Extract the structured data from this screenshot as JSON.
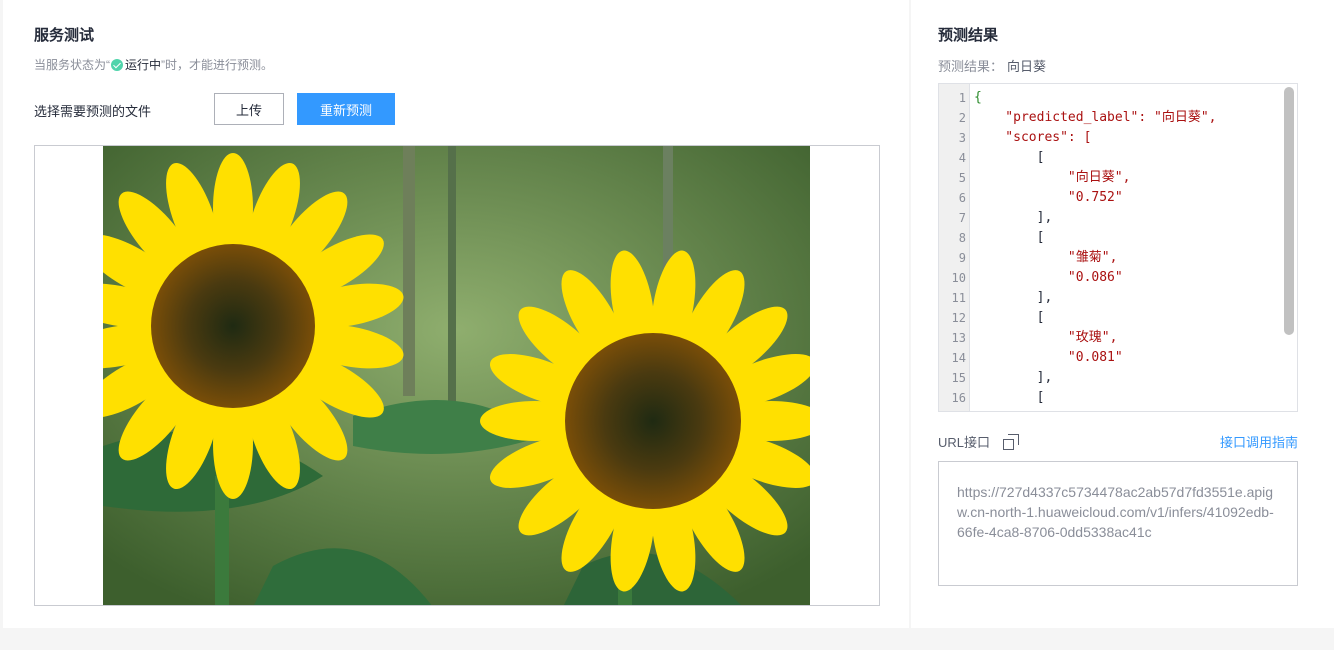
{
  "service_test": {
    "title": "服务测试",
    "hint_prefix": "当服务状态为“",
    "hint_status": "运行中",
    "hint_suffix": "”时，才能进行预测。",
    "file_label": "选择需要预测的文件",
    "upload_button": "上传",
    "repredict_button": "重新预测",
    "image_icon": "sunflower-photo"
  },
  "prediction": {
    "title": "预测结果",
    "result_label": "预测结果：",
    "result_value": "向日葵",
    "code_lines": [
      {
        "n": "1",
        "text": "{"
      },
      {
        "n": "2",
        "text": "    \"predicted_label\": \"向日葵\","
      },
      {
        "n": "3",
        "text": "    \"scores\": ["
      },
      {
        "n": "4",
        "text": "        ["
      },
      {
        "n": "5",
        "text": "            \"向日葵\","
      },
      {
        "n": "6",
        "text": "            \"0.752\""
      },
      {
        "n": "7",
        "text": "        ],"
      },
      {
        "n": "8",
        "text": "        ["
      },
      {
        "n": "9",
        "text": "            \"雏菊\","
      },
      {
        "n": "10",
        "text": "            \"0.086\""
      },
      {
        "n": "11",
        "text": "        ],"
      },
      {
        "n": "12",
        "text": "        ["
      },
      {
        "n": "13",
        "text": "            \"玫瑰\","
      },
      {
        "n": "14",
        "text": "            \"0.081\""
      },
      {
        "n": "15",
        "text": "        ],"
      },
      {
        "n": "16",
        "text": "        ["
      }
    ],
    "url_label": "URL接口",
    "guide_link": "接口调用指南",
    "url_value": "https://727d4337c5734478ac2ab57d7fd3551e.apigw.cn-north-1.huaweicloud.com/v1/infers/41092edb-66fe-4ca8-8706-0dd5338ac41c"
  },
  "colors": {
    "accent": "#3399ff",
    "status_ok": "#50d4ab"
  }
}
